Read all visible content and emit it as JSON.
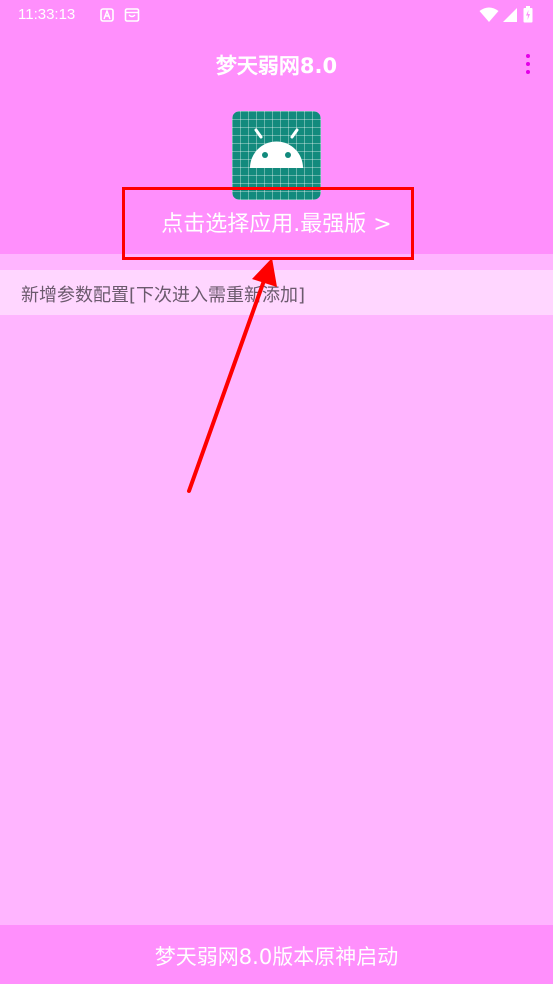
{
  "status_bar": {
    "time": "11:33:13",
    "icons": [
      "a-notification-icon",
      "store-icon",
      "wifi-icon",
      "signal-icon",
      "battery-icon"
    ]
  },
  "toolbar": {
    "title": "梦天弱网8.0",
    "menu_icon": "more-vert-icon"
  },
  "app_picker": {
    "icon": "android-icon",
    "label": "点击选择应用.最强版 >"
  },
  "config": {
    "add_label": "新增参数配置[下次进入需重新添加]"
  },
  "bottom": {
    "launch_label": "梦天弱网8.0版本原神启动"
  },
  "colors": {
    "header_bg": "#ff8ffc",
    "body_bg": "#ffb5ff",
    "config_bg": "#ffd6ff",
    "icon_bg": "#128a7d",
    "menu_dots": "#e400e8",
    "annotation": "#ff0000"
  }
}
